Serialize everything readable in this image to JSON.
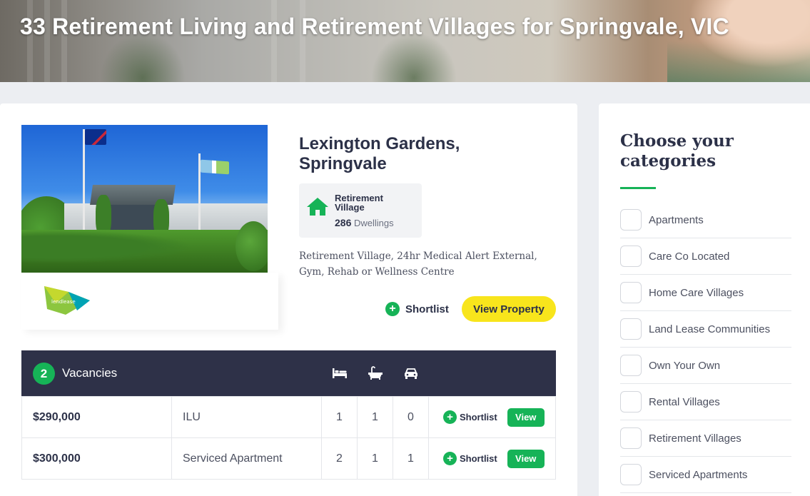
{
  "hero": {
    "title": "33 Retirement Living and Retirement Villages for Springvale, VIC"
  },
  "listing": {
    "title": "Lexington Gardens, Springvale",
    "brand": "lendlease",
    "type": {
      "label": "Retirement Village",
      "dwellings_count": "286",
      "dwellings_label": "Dwellings",
      "icon": "house-icon"
    },
    "features": "Retirement Village, 24hr Medical Alert External, Gym, Rehab or Wellness Centre",
    "shortlist_label": "Shortlist",
    "view_property_label": "View Property"
  },
  "vacancies": {
    "count": "2",
    "label": "Vacancies",
    "icons": [
      "bed-icon",
      "bath-icon",
      "car-icon"
    ],
    "rows": [
      {
        "price": "$290,000",
        "type": "ILU",
        "beds": "1",
        "baths": "1",
        "cars": "0",
        "shortlist": "Shortlist",
        "view": "View"
      },
      {
        "price": "$300,000",
        "type": "Serviced Apartment",
        "beds": "2",
        "baths": "1",
        "cars": "1",
        "shortlist": "Shortlist",
        "view": "View"
      }
    ]
  },
  "sidebar": {
    "title": "Choose your categories",
    "categories": [
      "Apartments",
      "Care Co Located",
      "Home Care Villages",
      "Land Lease Communities",
      "Own Your Own",
      "Rental Villages",
      "Retirement Villages",
      "Serviced Apartments"
    ]
  },
  "colors": {
    "accent_green": "#16b357",
    "cta_yellow": "#f8e51c",
    "navy": "#2e3148"
  }
}
